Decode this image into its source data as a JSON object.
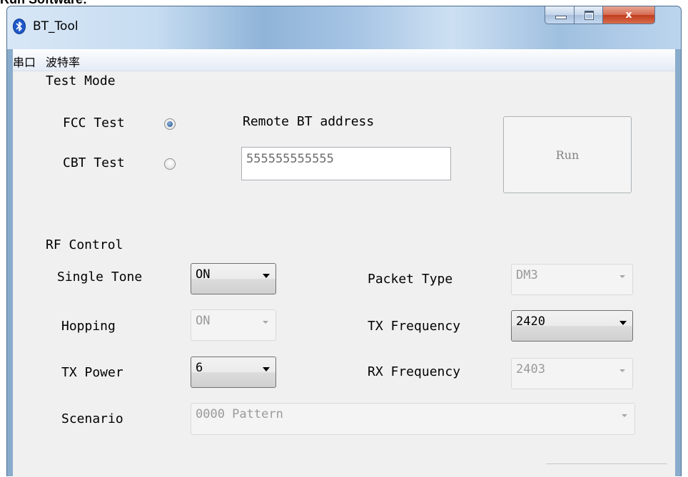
{
  "page_top_fragment": "Run Software:",
  "window": {
    "title": "BT_Tool",
    "close_glyph": "x"
  },
  "menu": {
    "items": [
      "串口",
      "波特率"
    ]
  },
  "test_mode": {
    "heading": "Test Mode",
    "fcc_label": "FCC Test",
    "cbt_label": "CBT Test",
    "selected": "FCC Test",
    "remote_label": "Remote BT address",
    "remote_value": "555555555555",
    "run_label": "Run"
  },
  "rf_control": {
    "heading": "RF Control",
    "single_tone": {
      "label": "Single Tone",
      "value": "ON",
      "enabled": true
    },
    "hopping": {
      "label": "Hopping",
      "value": "ON",
      "enabled": false
    },
    "tx_power": {
      "label": "TX Power",
      "value": "6",
      "enabled": true
    },
    "scenario": {
      "label": "Scenario",
      "value": "0000 Pattern",
      "enabled": false
    },
    "packet_type": {
      "label": "Packet Type",
      "value": "DM3",
      "enabled": false
    },
    "tx_frequency": {
      "label": "TX Frequency",
      "value": "2420",
      "enabled": true
    },
    "rx_frequency": {
      "label": "RX Frequency",
      "value": "2403",
      "enabled": false
    }
  },
  "colors": {
    "accent": "#1a4f8f",
    "close_button": "#c13c1f",
    "panel": "#f0f0f0"
  },
  "icons": {
    "app": "bluetooth-icon",
    "minimize": "minimize-icon",
    "maximize": "maximize-icon",
    "close": "close-icon",
    "dropdown": "chevron-down-icon"
  }
}
